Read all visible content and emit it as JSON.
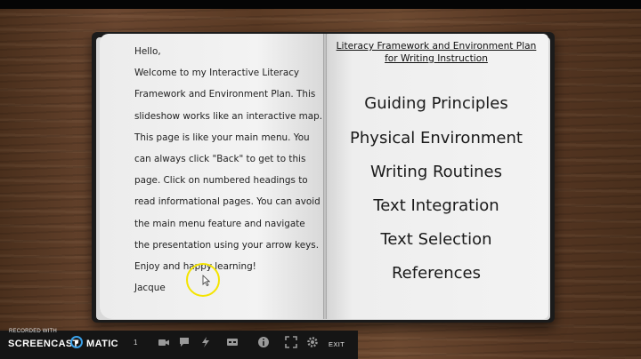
{
  "left_page": {
    "lines": [
      "Hello,",
      "Welcome to my Interactive Literacy",
      "Framework and Environment Plan. This",
      "slideshow works like an interactive map.",
      "This page is like your main menu. You",
      "can always click \"Back\" to get to this",
      "page. Click on numbered headings to",
      "read informational pages. You can avoid",
      "the main menu feature and navigate",
      "the presentation using your arrow keys.",
      "Enjoy and happy learning!",
      "Jacque"
    ]
  },
  "right_page": {
    "title_line1": "Literacy Framework and Environment Plan",
    "title_line2": "for Writing Instruction",
    "menu": [
      "Guiding Principles",
      "Physical Environment",
      "Writing Routines",
      "Text Integration",
      "Text Selection",
      "References"
    ]
  },
  "recorder": {
    "label": "RECORDED WITH",
    "brand_left": "SCREENCAST",
    "brand_right": "MATIC",
    "counter": "1",
    "exit_label": "EXIT"
  },
  "colors": {
    "cursor_highlight": "#f4e400",
    "brand_accent": "#3aa0e8"
  },
  "icons": [
    "webcam-icon",
    "comment-icon",
    "draw-icon",
    "caption-icon",
    "info-icon",
    "fullscreen-icon",
    "settings-icon"
  ]
}
